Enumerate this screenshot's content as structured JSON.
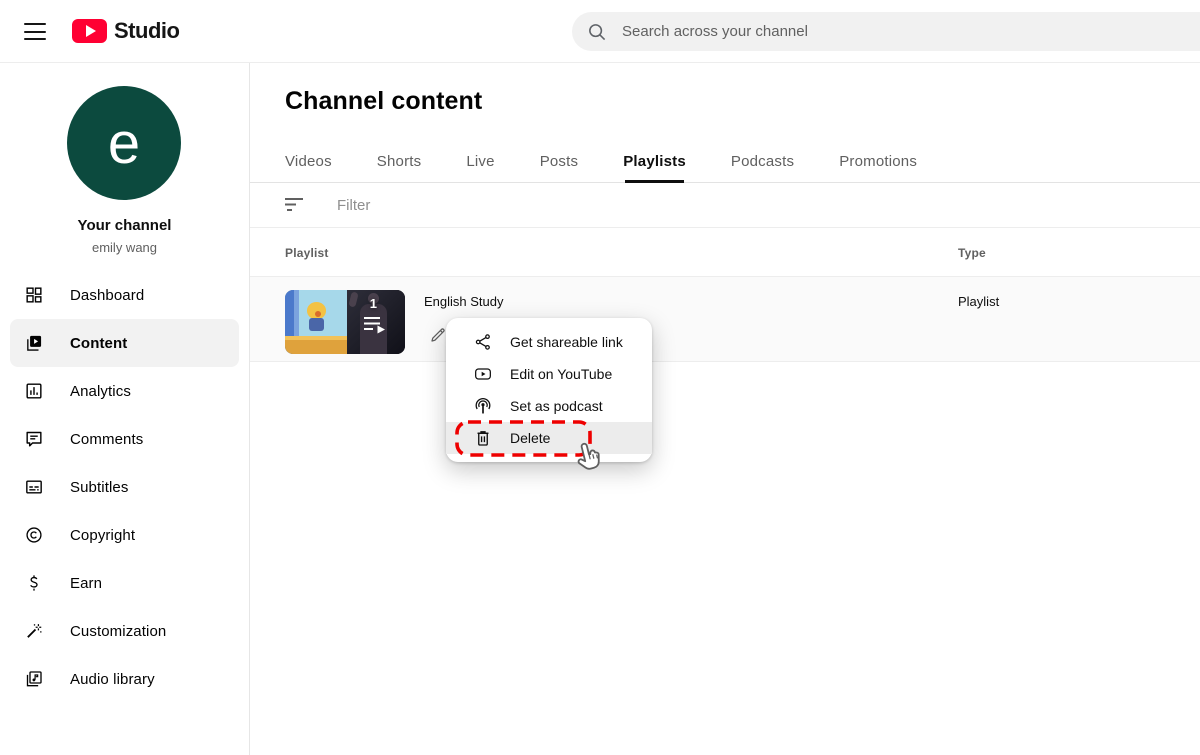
{
  "topbar": {
    "brand": "Studio",
    "search_placeholder": "Search across your channel"
  },
  "sidebar": {
    "avatar_letter": "e",
    "channel_label": "Your channel",
    "channel_name": "emily wang",
    "items": [
      {
        "label": "Dashboard",
        "icon": "dashboard-icon",
        "selected": false
      },
      {
        "label": "Content",
        "icon": "content-icon",
        "selected": true
      },
      {
        "label": "Analytics",
        "icon": "analytics-icon",
        "selected": false
      },
      {
        "label": "Comments",
        "icon": "comments-icon",
        "selected": false
      },
      {
        "label": "Subtitles",
        "icon": "subtitles-icon",
        "selected": false
      },
      {
        "label": "Copyright",
        "icon": "copyright-icon",
        "selected": false
      },
      {
        "label": "Earn",
        "icon": "earn-icon",
        "selected": false
      },
      {
        "label": "Customization",
        "icon": "customization-icon",
        "selected": false
      },
      {
        "label": "Audio library",
        "icon": "audio-library-icon",
        "selected": false
      }
    ]
  },
  "main": {
    "title": "Channel content",
    "tabs": [
      {
        "label": "Videos",
        "selected": false
      },
      {
        "label": "Shorts",
        "selected": false
      },
      {
        "label": "Live",
        "selected": false
      },
      {
        "label": "Posts",
        "selected": false
      },
      {
        "label": "Playlists",
        "selected": true
      },
      {
        "label": "Podcasts",
        "selected": false
      },
      {
        "label": "Promotions",
        "selected": false
      }
    ],
    "filter_placeholder": "Filter",
    "table": {
      "columns": [
        "Playlist",
        "Type"
      ],
      "rows": [
        {
          "title": "English Study",
          "type": "Playlist",
          "video_count": "1"
        }
      ]
    }
  },
  "context_menu": {
    "items": [
      {
        "label": "Get shareable link",
        "icon": "share-icon",
        "highlighted": false
      },
      {
        "label": "Edit on YouTube",
        "icon": "youtube-play-icon",
        "highlighted": false
      },
      {
        "label": "Set as podcast",
        "icon": "podcast-icon",
        "highlighted": false
      },
      {
        "label": "Delete",
        "icon": "trash-icon",
        "highlighted": true
      }
    ]
  },
  "colors": {
    "brand_red": "#ff0033",
    "avatar_green": "#0c4a3e",
    "highlight_dashed_red": "#ee0000",
    "selected_nav_bg": "#f2f2f2",
    "row_bg": "#fafafa"
  }
}
